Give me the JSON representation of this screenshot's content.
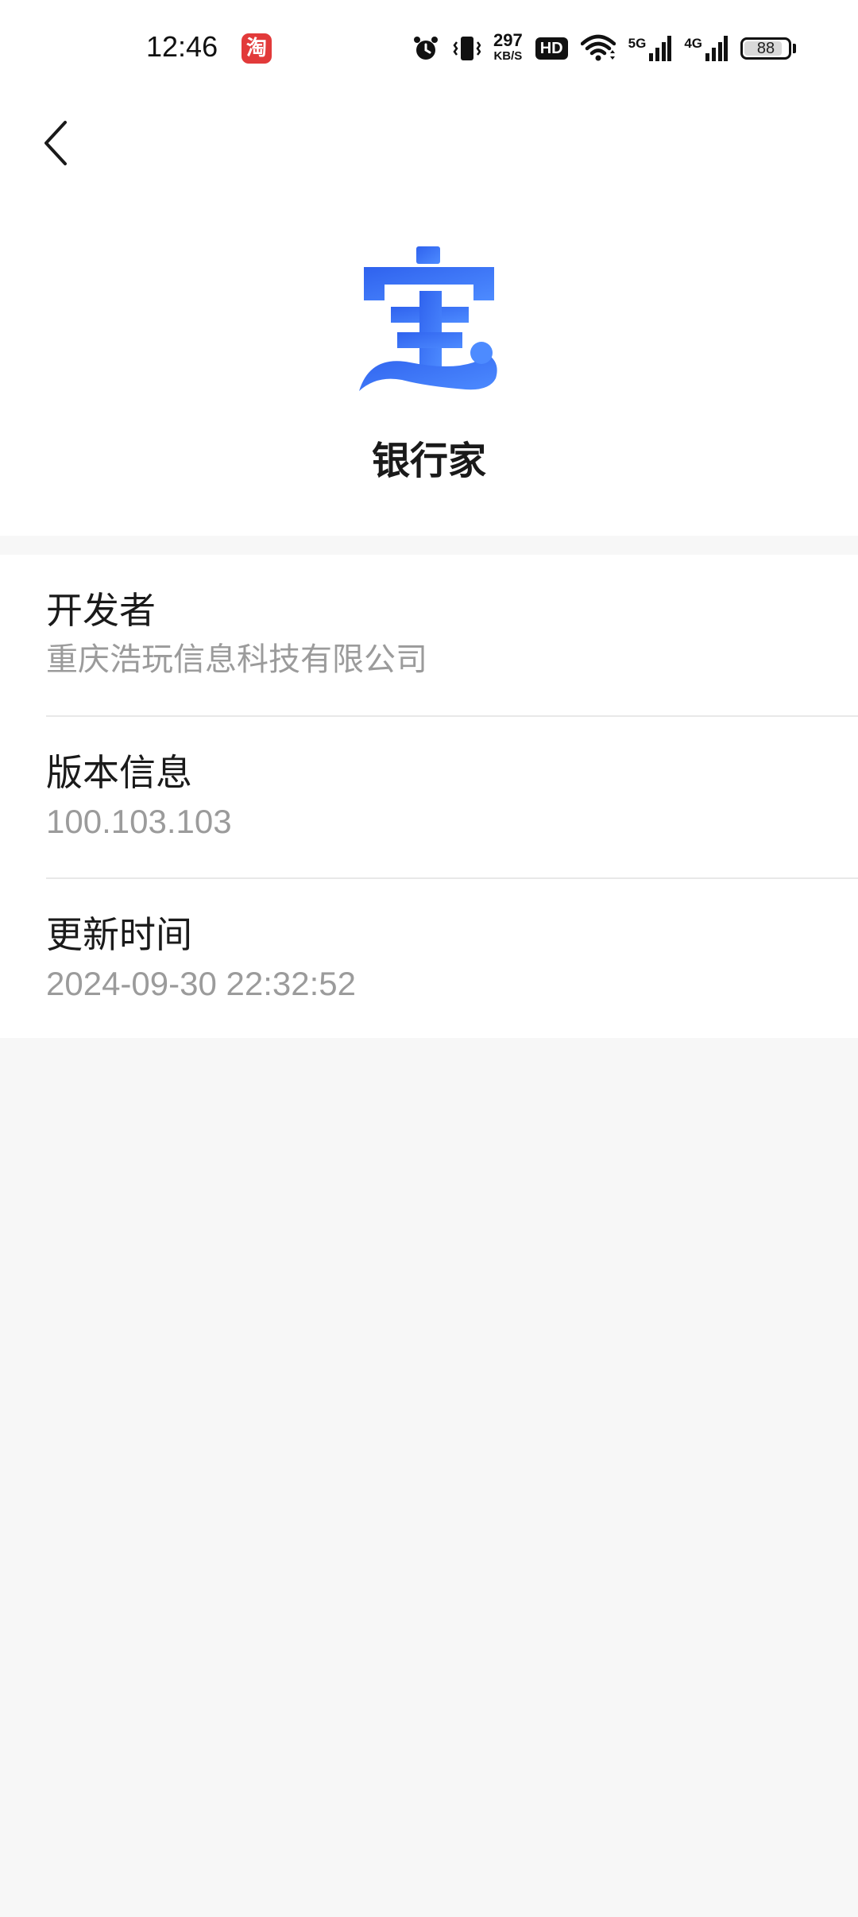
{
  "status_bar": {
    "time": "12:46",
    "taobao_glyph": "淘",
    "net_speed_value": "297",
    "net_speed_unit": "KB/S",
    "hd_label": "HD",
    "signal_1_label": "5G",
    "signal_2_label": "4G",
    "battery_level": "88",
    "battery_fraction": 0.88
  },
  "header": {
    "back_icon": "chevron-left-icon",
    "app_icon_glyph": "宝",
    "app_name": "银行家"
  },
  "info": {
    "items": [
      {
        "label": "开发者",
        "value": "重庆浩玩信息科技有限公司"
      },
      {
        "label": "版本信息",
        "value": "100.103.103"
      },
      {
        "label": "更新时间",
        "value": "2024-09-30 22:32:52"
      }
    ]
  },
  "colors": {
    "accent_blue": "#2f6cf0",
    "background": "#f7f7f7",
    "label_text": "#1a1a1a",
    "value_text": "#9b9b9b"
  }
}
